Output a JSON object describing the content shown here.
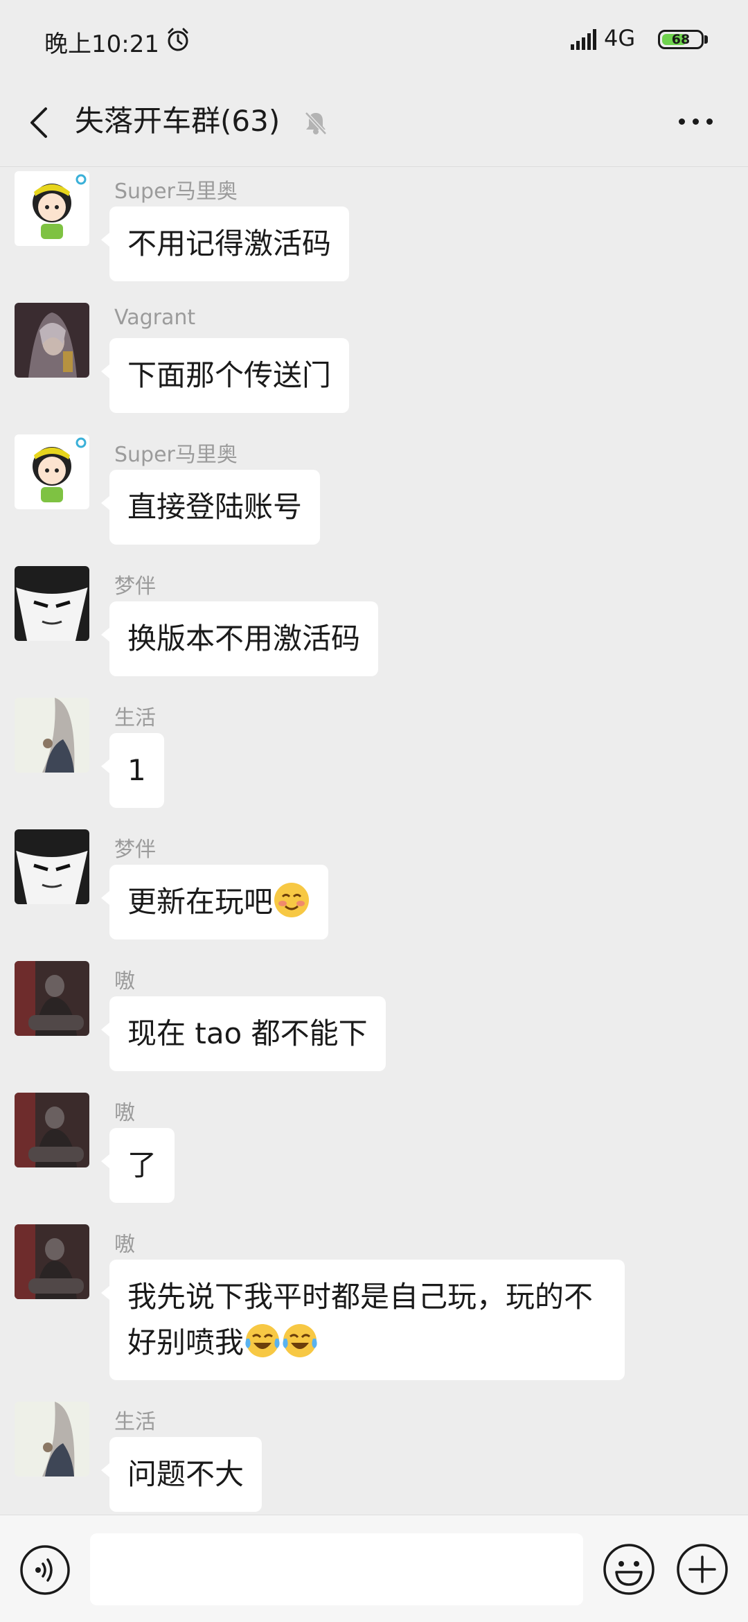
{
  "status_bar": {
    "time": "晚上10:21",
    "network": "4G",
    "battery": "68",
    "battery_level": 68
  },
  "header": {
    "title": "失落开车群(63)"
  },
  "messages": [
    {
      "sender": "Super马里奥",
      "text": "不用记得激活码",
      "avatar": "cartoon-girl"
    },
    {
      "sender": "Vagrant",
      "text": "下面那个传送门",
      "avatar": "hooded-warrior"
    },
    {
      "sender": "Super马里奥",
      "text": "直接登陆账号",
      "avatar": "cartoon-girl"
    },
    {
      "sender": "梦伴",
      "text": "换版本不用激活码",
      "avatar": "manga-face"
    },
    {
      "sender": "生活",
      "text": "1",
      "avatar": "long-hair-girl"
    },
    {
      "sender": "梦伴",
      "text": "更新在玩吧",
      "emoji": [
        "blushing-smile"
      ],
      "avatar": "manga-face"
    },
    {
      "sender": "嗷",
      "text": "现在 tao 都不能下",
      "avatar": "dark-figure"
    },
    {
      "sender": "嗷",
      "text": "了",
      "avatar": "dark-figure"
    },
    {
      "sender": "嗷",
      "text": "我先说下我平时都是自己玩，玩的不好别喷我",
      "emoji": [
        "tears-of-joy",
        "tears-of-joy"
      ],
      "avatar": "dark-figure"
    },
    {
      "sender": "生活",
      "text": "问题不大",
      "avatar": "long-hair-girl"
    }
  ],
  "colors": {
    "background": "#ededed",
    "bubble": "#ffffff",
    "sender": "#9b9b9b",
    "battery": "#6fd24e"
  }
}
